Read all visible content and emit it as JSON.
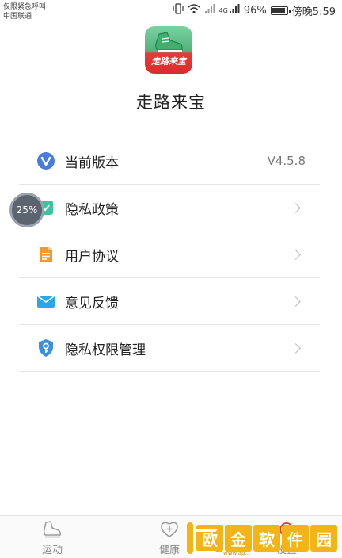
{
  "status_bar": {
    "carrier_line1": "仅限紧急呼叫",
    "carrier_line2": "中国联通",
    "network": "4G",
    "battery": "96%",
    "time": "傍晚5:59"
  },
  "app": {
    "logo_text": "走路来宝",
    "name": "走路来宝"
  },
  "menu": {
    "items": [
      {
        "label": "当前版本",
        "value": "V4.5.8",
        "icon": "v-badge-icon"
      },
      {
        "label": "隐私政策",
        "icon": "privacy-policy-icon"
      },
      {
        "label": "用户协议",
        "icon": "document-icon"
      },
      {
        "label": "意见反馈",
        "icon": "mail-icon"
      },
      {
        "label": "隐私权限管理",
        "icon": "shield-key-icon"
      }
    ]
  },
  "progress": {
    "text": "25%",
    "value": 0.25
  },
  "tabs": [
    {
      "label": "运动",
      "icon": "shoe-icon"
    },
    {
      "label": "健康",
      "icon": "heart-plus-icon"
    },
    {
      "label": "设置",
      "icon": "settings-icon"
    }
  ],
  "watermark": {
    "chars": [
      "欧",
      "金",
      "软",
      "件",
      "园"
    ],
    "url": "www.ap..."
  },
  "colors": {
    "accent_blue": "#4a7be0",
    "orange": "#f09a2c",
    "cyan": "#2aa8e6",
    "logo_green": "#5bc489",
    "logo_red": "#e03434",
    "watermark_yellow": "#f2b416"
  }
}
